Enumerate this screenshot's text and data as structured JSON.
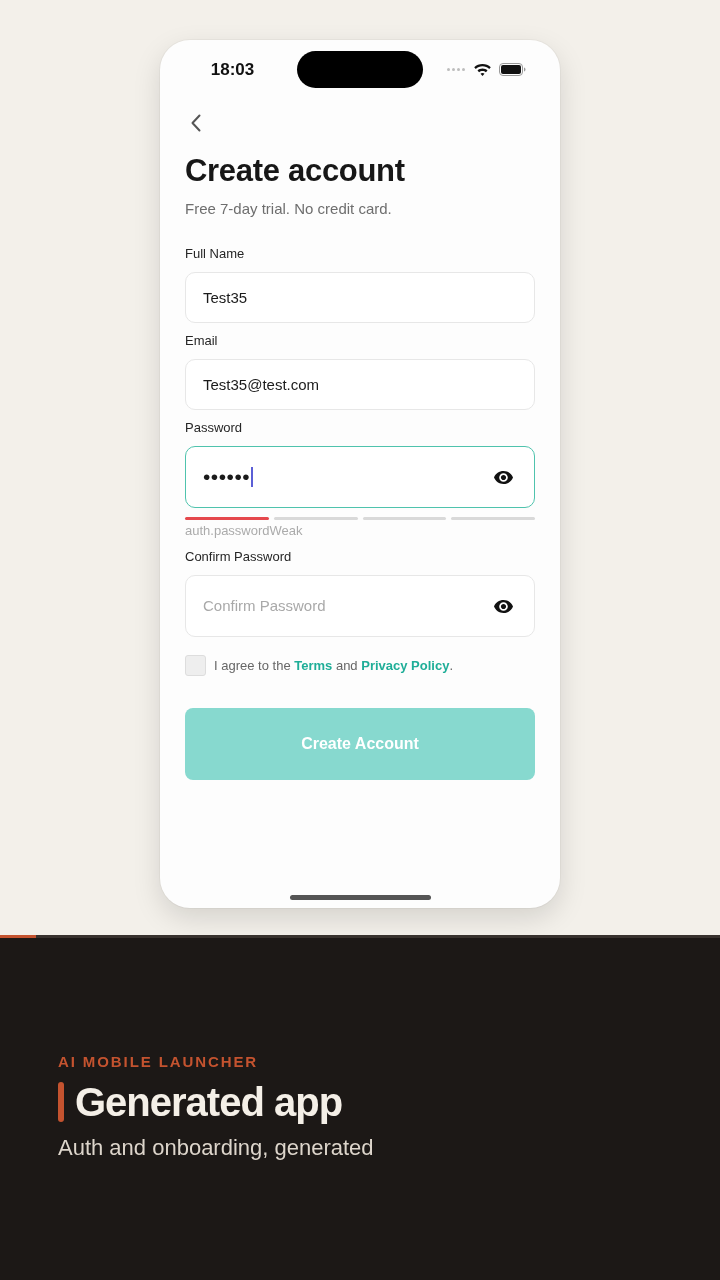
{
  "status_bar": {
    "time": "18:03"
  },
  "header": {
    "title": "Create account",
    "subtitle": "Free 7-day trial. No credit card."
  },
  "fields": [
    {
      "kind": "text",
      "label": "Full Name",
      "value": "Test35",
      "focused": false
    },
    {
      "kind": "email",
      "label": "Email",
      "value": "Test35@test.com",
      "focused": false
    },
    {
      "kind": "password",
      "label": "Password",
      "value": "••••••",
      "focused": true,
      "strength": {
        "segments": [
          {
            "filled": true
          },
          {
            "filled": false
          },
          {
            "filled": false
          },
          {
            "filled": false
          }
        ],
        "hint": "auth.passwordWeak"
      }
    },
    {
      "kind": "password",
      "label": "Confirm Password",
      "placeholder": "Confirm Password",
      "focused": false
    }
  ],
  "agreement": {
    "checked": false,
    "segments": [
      {
        "kind": "text",
        "text": "I agree to the "
      },
      {
        "kind": "link",
        "text": "Terms"
      },
      {
        "kind": "text",
        "text": " and "
      },
      {
        "kind": "link",
        "text": "Privacy Policy"
      },
      {
        "kind": "text",
        "text": "."
      }
    ]
  },
  "submit_button": {
    "label": "Create Account",
    "disabled": true
  },
  "progress": {
    "level": 0.05
  },
  "caption": {
    "eyebrow": "AI MOBILE LAUNCHER",
    "title": "Generated app",
    "subtitle": "Auth and onboarding, generated"
  }
}
